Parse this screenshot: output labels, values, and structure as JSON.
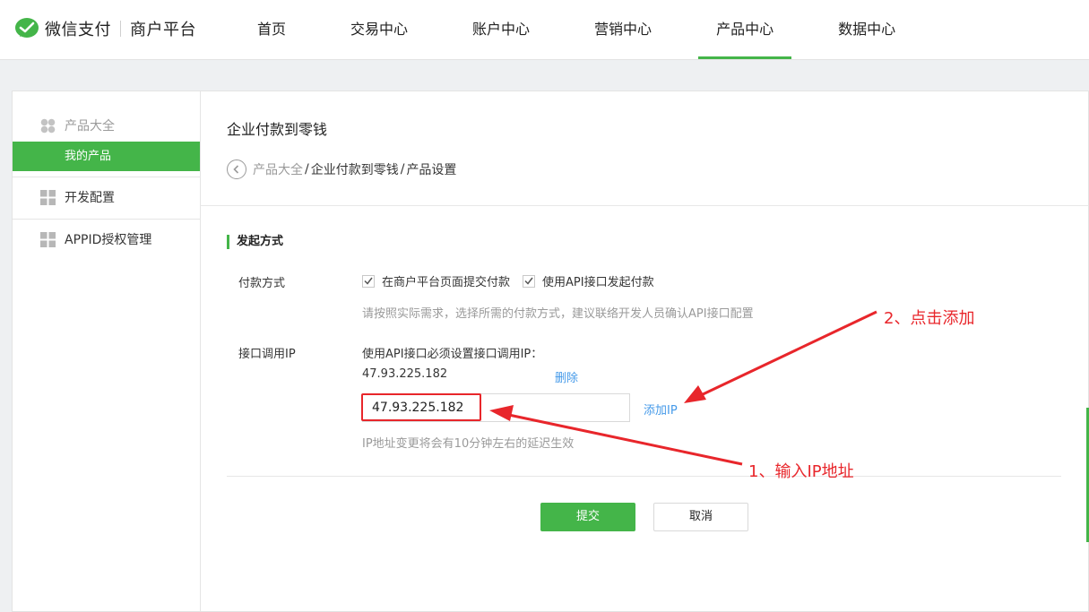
{
  "brand": {
    "name": "微信支付",
    "subtitle": "商户平台",
    "icon": "wechat-pay-logo",
    "accent_color": "#44b549"
  },
  "nav": {
    "items": [
      {
        "label": "首页",
        "active": false
      },
      {
        "label": "交易中心",
        "active": false
      },
      {
        "label": "账户中心",
        "active": false
      },
      {
        "label": "营销中心",
        "active": false
      },
      {
        "label": "产品中心",
        "active": true
      },
      {
        "label": "数据中心",
        "active": false
      }
    ]
  },
  "sidebar": {
    "product_all": "产品大全",
    "my_products": "我的产品",
    "dev_config": "开发配置",
    "appid_manage": "APPID授权管理"
  },
  "page": {
    "title": "企业付款到零钱",
    "breadcrumb": [
      "产品大全",
      "企业付款到零钱",
      "产品设置"
    ]
  },
  "form": {
    "section_title": "发起方式",
    "payment_method_label": "付款方式",
    "options": [
      {
        "label": "在商户平台页面提交付款",
        "checked": true
      },
      {
        "label": "使用API接口发起付款",
        "checked": true
      }
    ],
    "payment_tip": "请按照实际需求，选择所需的付款方式，建议联络开发人员确认API接口配置",
    "ip_label": "接口调用IP",
    "ip_desc": "使用API接口必须设置接口调用IP：",
    "existing_ip": "47.93.225.182",
    "delete_label": "删除",
    "ip_input_value": "47.93.225.182",
    "add_ip_label": "添加IP",
    "ip_tip": "IP地址变更将会有10分钟左右的延迟生效",
    "submit_label": "提交",
    "cancel_label": "取消"
  },
  "annotations": {
    "step1": "1、输入IP地址",
    "step2": "2、点击添加",
    "color": "#e8262b"
  }
}
